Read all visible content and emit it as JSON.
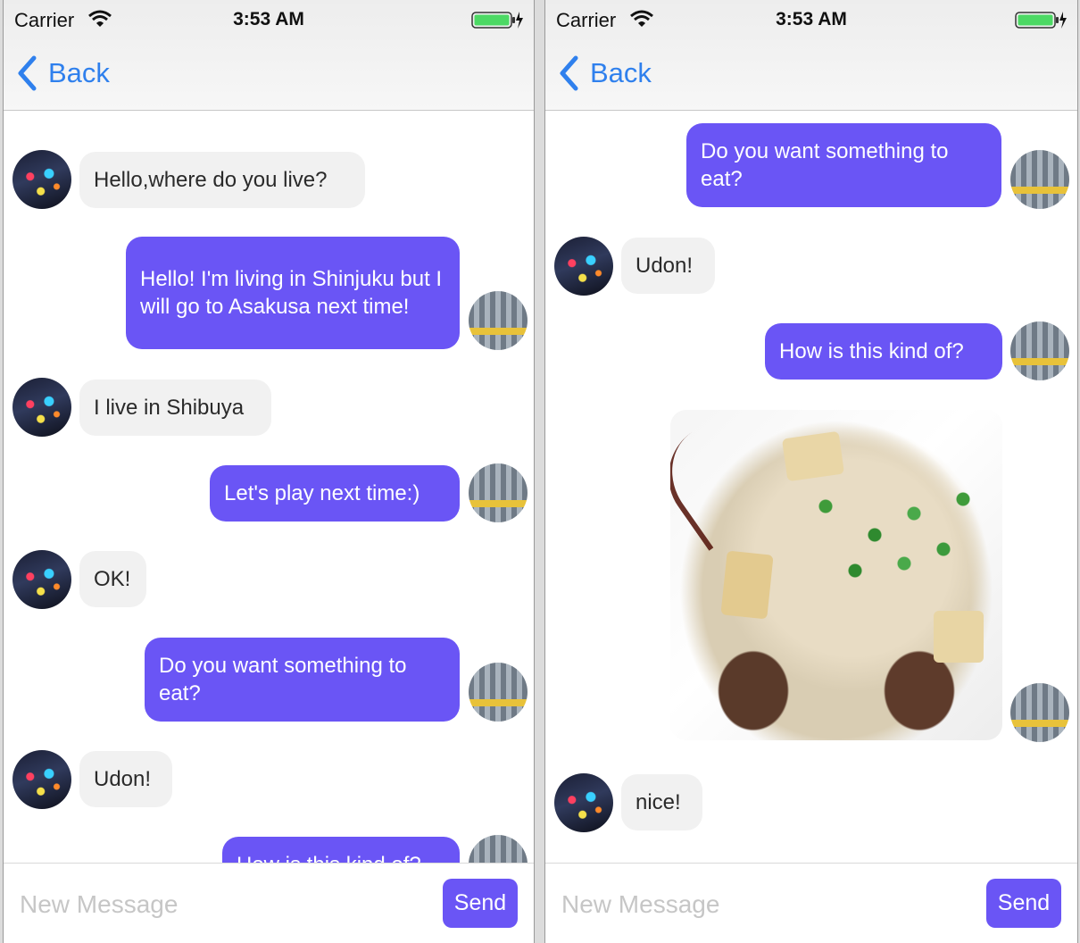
{
  "status_bar": {
    "carrier": "Carrier",
    "time": "3:53 AM"
  },
  "nav": {
    "back_label": "Back"
  },
  "left_chat": {
    "messages": [
      {
        "text": "Hello,where do you live?"
      },
      {
        "text": "Hello! I'm living in Shinjuku but I will go to Asakusa next time!"
      },
      {
        "text": "I live in Shibuya"
      },
      {
        "text": "Let's play next time:)"
      },
      {
        "text": "OK!"
      },
      {
        "text": "Do you want something to eat?"
      },
      {
        "text": "Udon!"
      },
      {
        "text": "How is this kind of?"
      }
    ]
  },
  "right_chat": {
    "messages": [
      {
        "text": "Do you want something to eat?"
      },
      {
        "text": "Udon!"
      },
      {
        "text": "How is this kind of?"
      },
      {
        "text": "nice!"
      }
    ]
  },
  "composer": {
    "placeholder": "New Message",
    "send_label": "Send"
  },
  "colors": {
    "outgoing_bubble": "#6a55f5",
    "incoming_bubble": "#f1f1f1",
    "back_link": "#2f80ed",
    "battery_fill": "#4cd964"
  },
  "icons": [
    "wifi-icon",
    "battery-icon",
    "back-chevron-icon",
    "avatar",
    "food-photo"
  ]
}
